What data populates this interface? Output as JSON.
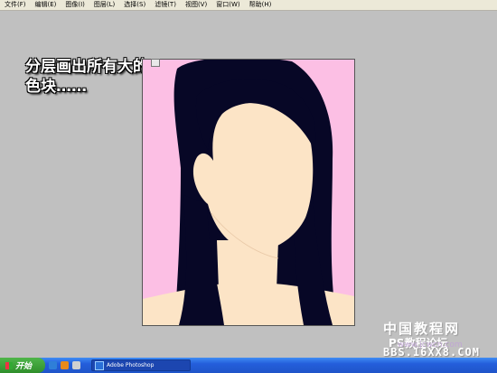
{
  "menu": [
    "文件(F)",
    "编辑(E)",
    "图像(I)",
    "图层(L)",
    "选择(S)",
    "滤镜(T)",
    "视图(V)",
    "窗口(W)",
    "帮助(H)"
  ],
  "caption": {
    "line1": "分层画出所有大的",
    "line2": "色块……"
  },
  "watermark": {
    "line1": "中国教程网",
    "line2": "PS教程论坛",
    "line3": "www.jcwcn.com",
    "line4": "BBS.16XX8.COM"
  },
  "taskbar": {
    "start_label": "开始",
    "task_label": "Adobe Photoshop"
  },
  "colors": {
    "canvas_bg": "#fcbfe4",
    "hair": "#070726",
    "skin": "#fce4c6",
    "workspace": "#c0c0c0"
  },
  "icons": [
    "windows-flag-icon",
    "ie-icon",
    "media-icon",
    "folder-icon",
    "photoshop-icon"
  ]
}
